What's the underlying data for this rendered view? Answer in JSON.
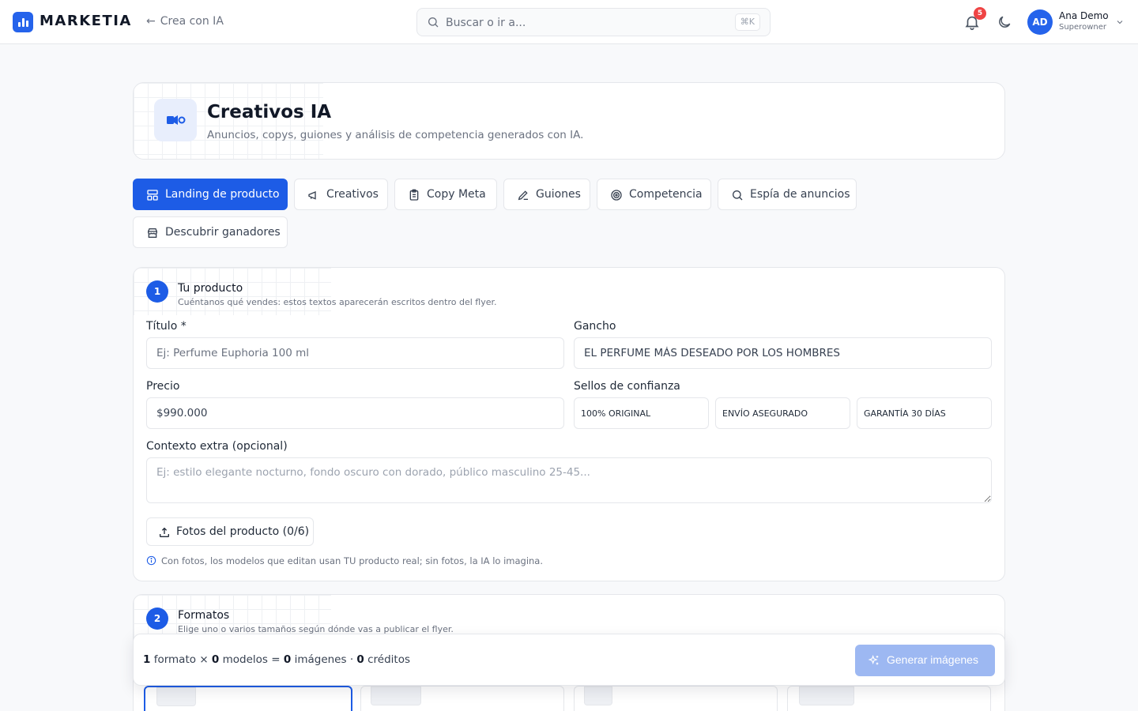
{
  "app": {
    "brand": "MARKETIA",
    "back_label": "Crea con IA",
    "search_placeholder": "Buscar o ir a...",
    "search_shortcut": "⌘K",
    "notifications_count": "5",
    "user": {
      "initials": "AD",
      "name": "Ana Demo",
      "role": "Superowner"
    },
    "accent": "#1d5ce6"
  },
  "hero": {
    "title": "Creativos IA",
    "subtitle": "Anuncios, copys, guiones y análisis de competencia generados con IA."
  },
  "tabs": [
    {
      "label": "Landing de producto",
      "icon": "layout-icon",
      "active": true
    },
    {
      "label": "Creativos",
      "icon": "megaphone-icon",
      "active": false
    },
    {
      "label": "Copy Meta",
      "icon": "clipboard-icon",
      "active": false
    },
    {
      "label": "Guiones",
      "icon": "pencil-icon",
      "active": false
    },
    {
      "label": "Competencia",
      "icon": "target-icon",
      "active": false
    },
    {
      "label": "Espía de anuncios",
      "icon": "search-icon",
      "active": false
    },
    {
      "label": "Descubrir ganadores",
      "icon": "store-icon",
      "active": false
    }
  ],
  "step1": {
    "number": "1",
    "title": "Tu producto",
    "subtitle": "Cuéntanos qué vendes: estos textos aparecerán escritos dentro del flyer.",
    "titulo_label": "Título *",
    "titulo_placeholder": "Ej: Perfume Euphoria 100 ml",
    "gancho_label": "Gancho",
    "gancho_value": "EL PERFUME MÁS DESEADO POR LOS HOMBRES",
    "precio_label": "Precio",
    "precio_value": "$990.000",
    "sellos_label": "Sellos de confianza",
    "sellos": [
      "100% ORIGINAL",
      "ENVÍO ASEGURADO",
      "GARANTÍA 30 DÍAS"
    ],
    "contexto_label": "Contexto extra (opcional)",
    "contexto_placeholder": "Ej: estilo elegante nocturno, fondo oscuro con dorado, público masculino 25-45...",
    "photos_label": "Fotos del producto (0/6)",
    "info": "Con fotos, los modelos que editan usan TU producto real; sin fotos, la IA lo imagina."
  },
  "step2": {
    "number": "2",
    "title": "Formatos",
    "subtitle": "Elige uno o varios tamaños según dónde vas a publicar el flyer."
  },
  "summary": {
    "formats_count": "1",
    "formats_word": "formato",
    "times": "×",
    "models_count": "0",
    "models_word": "modelos",
    "equals": "=",
    "images_count": "0",
    "images_word": "imágenes",
    "dot": "·",
    "credits_count": "0",
    "credits_word": "créditos"
  },
  "generate_label": "Generar imágenes"
}
